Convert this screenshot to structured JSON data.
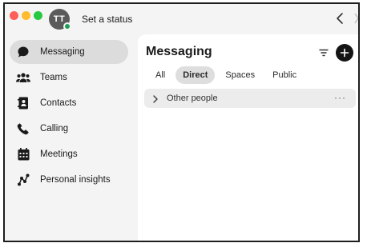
{
  "titlebar": {
    "avatar_initials": "TT",
    "status_text": "Set a status",
    "icons": [
      "close-dot",
      "minimize-dot",
      "zoom-dot",
      "back-chevron-icon"
    ]
  },
  "sidebar": {
    "items": [
      {
        "label": "Messaging",
        "icon": "chat-bubble-icon",
        "active": true
      },
      {
        "label": "Teams",
        "icon": "people-icon",
        "active": false
      },
      {
        "label": "Contacts",
        "icon": "contact-book-icon",
        "active": false
      },
      {
        "label": "Calling",
        "icon": "phone-icon",
        "active": false
      },
      {
        "label": "Meetings",
        "icon": "calendar-icon",
        "active": false
      },
      {
        "label": "Personal insights",
        "icon": "insights-icon",
        "active": false
      }
    ]
  },
  "main": {
    "title": "Messaging",
    "tabs": [
      {
        "label": "All",
        "active": false
      },
      {
        "label": "Direct",
        "active": true
      },
      {
        "label": "Spaces",
        "active": false
      },
      {
        "label": "Public",
        "active": false
      }
    ],
    "group_row": {
      "label": "Other people",
      "more": "···"
    }
  },
  "colors": {
    "presence": "#1f9d55",
    "active_nav": "#dcdcdc",
    "add_button": "#141414"
  }
}
